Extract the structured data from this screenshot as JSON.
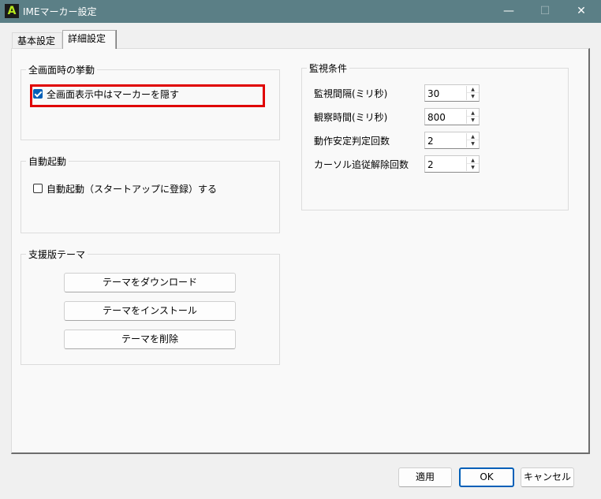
{
  "window": {
    "app_icon_letter": "A",
    "title": "IMEマーカー設定",
    "min_glyph": "—",
    "max_glyph": "☐",
    "close_glyph": "✕"
  },
  "tabs": [
    {
      "label": "基本設定",
      "active": false
    },
    {
      "label": "詳細設定",
      "active": true
    }
  ],
  "fullscreen_group": {
    "title": "全画面時の挙動",
    "hide_marker_label": "全画面表示中はマーカーを隠す",
    "hide_marker_checked": true
  },
  "autostart_group": {
    "title": "自動起動",
    "autostart_label": "自動起動（スタートアップに登録）する",
    "autostart_checked": false
  },
  "theme_group": {
    "title": "支援版テーマ",
    "download_label": "テーマをダウンロード",
    "install_label": "テーマをインストール",
    "delete_label": "テーマを削除"
  },
  "monitor_group": {
    "title": "監視条件",
    "fields": [
      {
        "label": "監視間隔(ミリ秒)",
        "value": "30"
      },
      {
        "label": "観察時間(ミリ秒)",
        "value": "800"
      },
      {
        "label": "動作安定判定回数",
        "value": "2"
      },
      {
        "label": "カーソル追従解除回数",
        "value": "2"
      }
    ]
  },
  "footer": {
    "apply_label": "適用",
    "ok_label": "OK",
    "cancel_label": "キャンセル"
  },
  "colors": {
    "titlebar": "#5b7f86",
    "accent": "#005fb8",
    "highlight_box": "#e00000"
  }
}
